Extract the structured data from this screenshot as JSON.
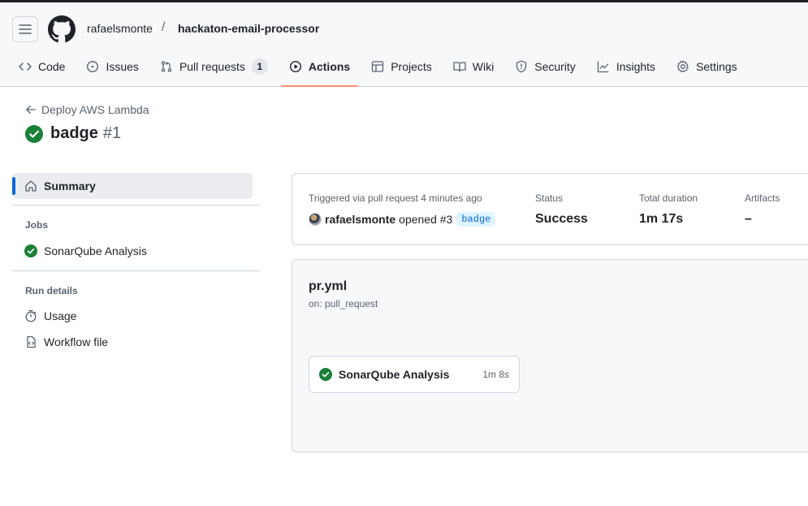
{
  "header": {
    "owner": "rafaelsmonte",
    "separator": "/",
    "repo": "hackaton-email-processor"
  },
  "tabs": [
    {
      "label": "Code",
      "icon": "code-icon"
    },
    {
      "label": "Issues",
      "icon": "issue-icon"
    },
    {
      "label": "Pull requests",
      "icon": "pull-request-icon",
      "count": "1"
    },
    {
      "label": "Actions",
      "icon": "play-icon",
      "selected": true
    },
    {
      "label": "Projects",
      "icon": "table-icon"
    },
    {
      "label": "Wiki",
      "icon": "book-icon"
    },
    {
      "label": "Security",
      "icon": "shield-icon"
    },
    {
      "label": "Insights",
      "icon": "graph-icon"
    },
    {
      "label": "Settings",
      "icon": "gear-icon"
    }
  ],
  "page": {
    "back_label": "Deploy AWS Lambda",
    "run_title": "badge",
    "run_number": "#1"
  },
  "sidebar": {
    "summary_label": "Summary",
    "jobs_heading": "Jobs",
    "job_label": "SonarQube Analysis",
    "run_details_heading": "Run details",
    "usage_label": "Usage",
    "workflow_file_label": "Workflow file"
  },
  "summary": {
    "triggered_text": "Triggered via pull request 4 minutes ago",
    "actor": "rafaelsmonte",
    "action": "opened #3",
    "branch": "badge",
    "status_label": "Status",
    "status_value": "Success",
    "duration_label": "Total duration",
    "duration_value": "1m 17s",
    "artifacts_label": "Artifacts",
    "artifacts_value": "–"
  },
  "workflow": {
    "file_name": "pr.yml",
    "trigger": "on: pull_request",
    "job_name": "SonarQube Analysis",
    "job_duration": "1m 8s"
  },
  "colors": {
    "success": "#1a7f37",
    "accent": "#0969da",
    "selected_tab_underline": "#fd8c73"
  }
}
